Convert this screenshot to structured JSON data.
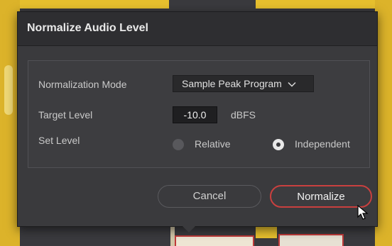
{
  "dialog": {
    "title": "Normalize Audio Level",
    "fields": {
      "mode_label": "Normalization Mode",
      "mode_value": "Sample Peak Program",
      "target_label": "Target Level",
      "target_value": "-10.0",
      "target_unit": "dBFS",
      "set_level_label": "Set Level",
      "options": [
        {
          "label": "Relative",
          "selected": false
        },
        {
          "label": "Independent",
          "selected": true
        }
      ]
    },
    "buttons": {
      "cancel": "Cancel",
      "normalize": "Normalize"
    }
  },
  "colors": {
    "accent": "#c9403f",
    "clip_yellow": "#e7c02e",
    "dialog_bg": "#3a3a3d"
  },
  "icons": [
    "chevron-down-icon",
    "cursor-icon",
    "radio-icon"
  ]
}
